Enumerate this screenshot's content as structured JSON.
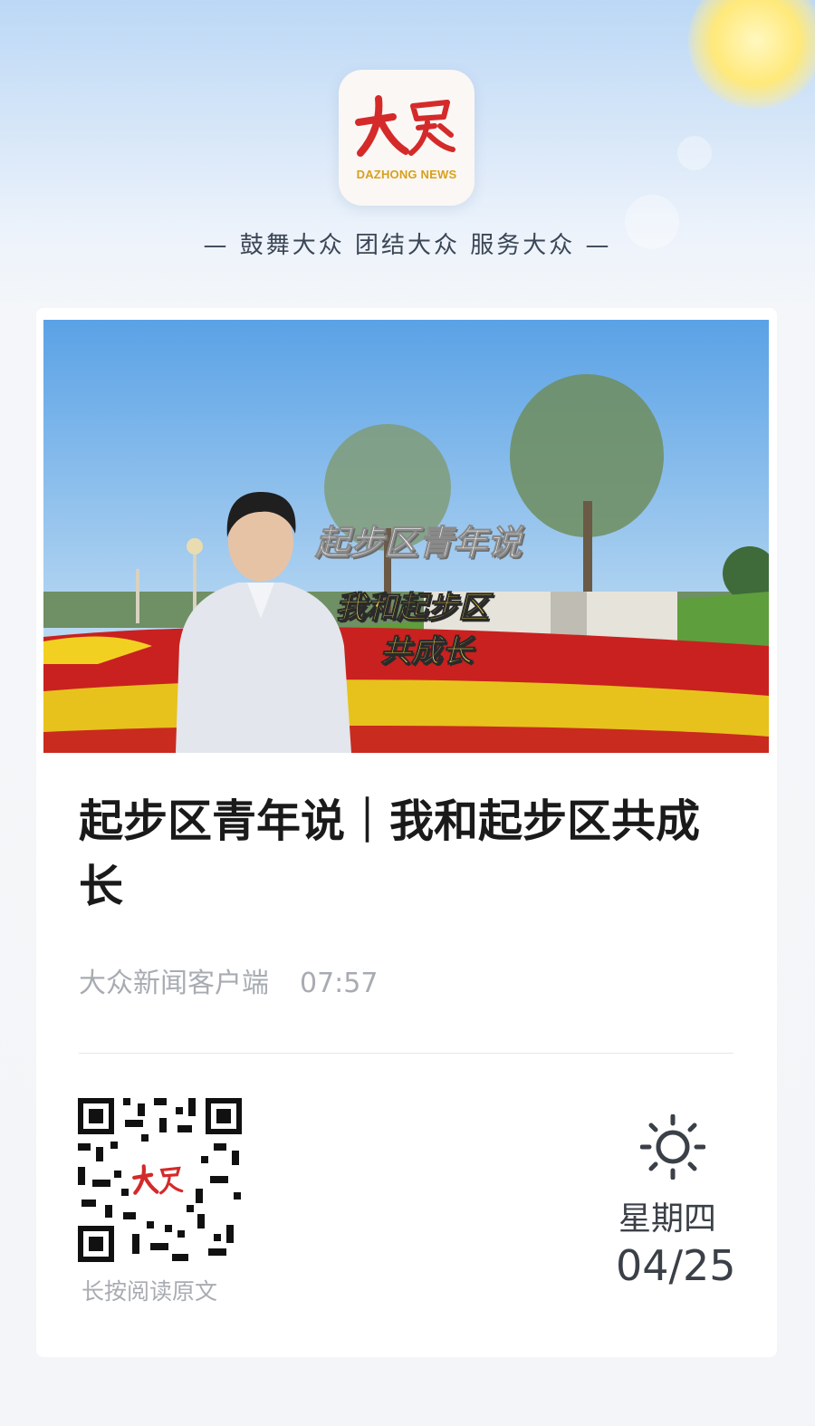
{
  "brand": {
    "logo_text": "DAZHONG NEWS",
    "slogan": "— 鼓舞大众  团结大众  服务大众 —",
    "accent_red": "#d42a2a",
    "accent_gold": "#d8a01c"
  },
  "hero": {
    "caption_top": "起步区青年说",
    "caption_line1": "我和起步区",
    "caption_line2": "共成长"
  },
  "article": {
    "title": "起步区青年说｜我和起步区共成长",
    "source": "大众新闻客户端",
    "time": "07:57"
  },
  "footer": {
    "qr_caption": "长按阅读原文",
    "weather_icon": "sun-icon",
    "weekday": "星期四",
    "date": "04/25"
  }
}
